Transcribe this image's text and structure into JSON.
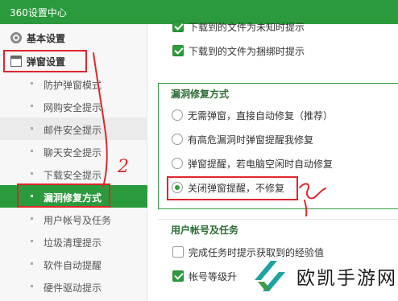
{
  "window": {
    "title": "360设置中心"
  },
  "sidebar": {
    "groups": [
      {
        "label": "基本设置",
        "icon": "gear-icon"
      },
      {
        "label": "弹窗设置",
        "icon": "window-icon"
      }
    ],
    "items": [
      {
        "label": "防护弹窗模式"
      },
      {
        "label": "网购安全提示"
      },
      {
        "label": "邮件安全提示"
      },
      {
        "label": "聊天安全提示"
      },
      {
        "label": "下载安全提示"
      },
      {
        "label": "漏洞修复方式",
        "selected": true
      },
      {
        "label": "用户帐号及任务"
      },
      {
        "label": "垃圾清理提示"
      },
      {
        "label": "软件自动提醒"
      },
      {
        "label": "硬件驱动提示"
      }
    ]
  },
  "download": {
    "options": [
      {
        "label": "下载到的文件为未知时提示",
        "checked": true
      },
      {
        "label": "下载到的文件为捆绑时提示",
        "checked": true
      }
    ]
  },
  "vuln_repair": {
    "title": "漏洞修复方式",
    "options": [
      {
        "label": "无需弹窗，直接自动修复（推荐）",
        "selected": false
      },
      {
        "label": "有高危漏洞时弹窗提醒我修复",
        "selected": false
      },
      {
        "label": "弹窗提醒，若电脑空闲时自动修复",
        "selected": false
      },
      {
        "label": "关闭弹窗提醒，不修复",
        "selected": true
      }
    ]
  },
  "account": {
    "title": "用户帐号及任务",
    "options": [
      {
        "label": "完成任务时提示获取到的经验值",
        "checked": false
      },
      {
        "label": "帐号等级升",
        "checked": true
      }
    ]
  },
  "annotations": {
    "number_label": "2"
  },
  "watermark": {
    "text": "欧凯手游网"
  },
  "colors": {
    "accent": "#2b9a3d",
    "annotation": "#e0262b"
  }
}
